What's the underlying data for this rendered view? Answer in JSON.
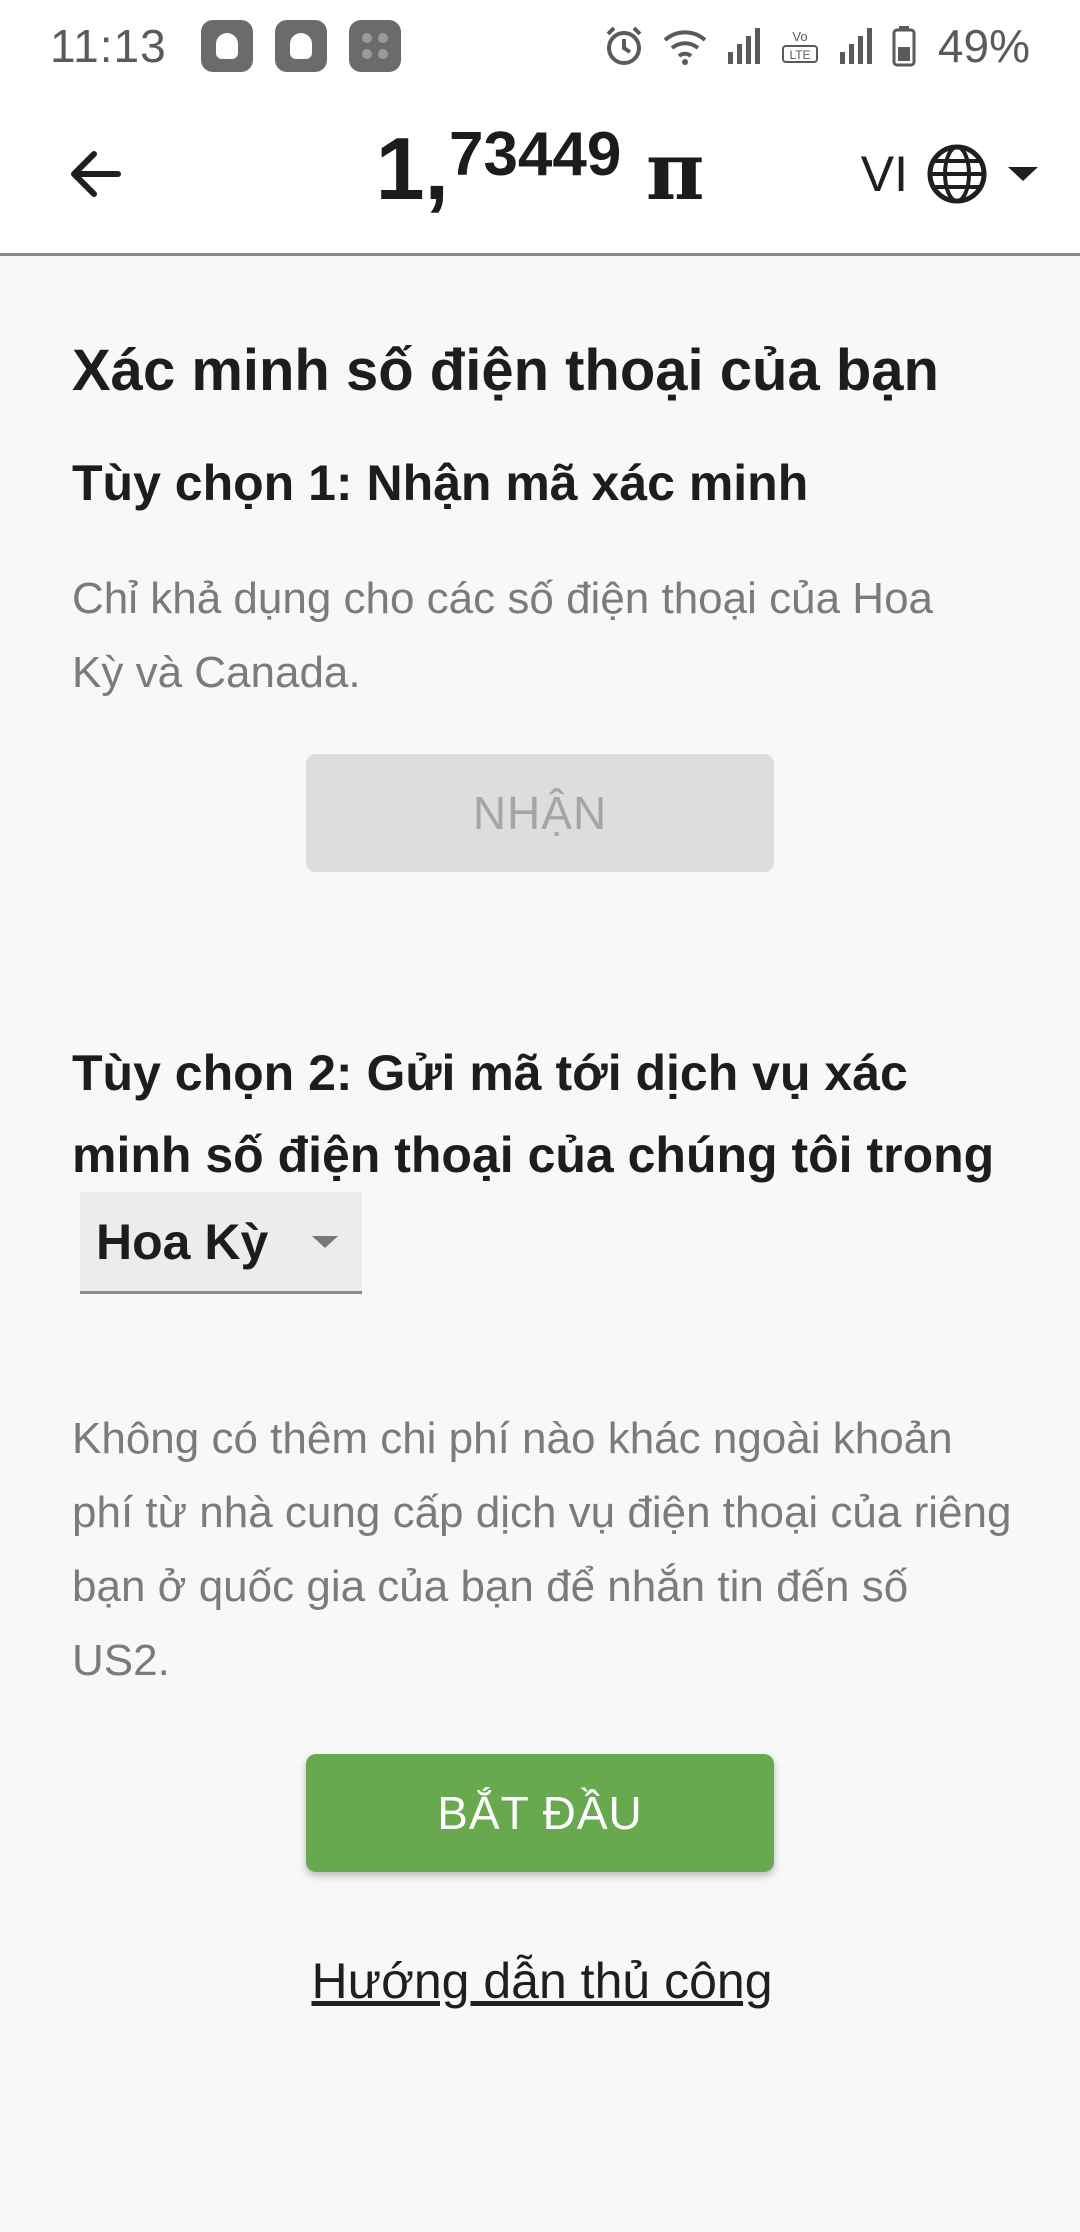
{
  "status_bar": {
    "time": "11:13",
    "battery_percent": "49%",
    "icons": [
      "notification-icon",
      "notification-icon",
      "app-icon",
      "alarm-icon",
      "wifi-icon",
      "signal-icon",
      "volte-icon",
      "signal-icon",
      "battery-icon"
    ]
  },
  "header": {
    "balance_main": "1,",
    "balance_sup": "73449",
    "balance_symbol": "π",
    "language": "VI",
    "back_icon": "arrow-left-icon",
    "globe_icon": "globe-icon"
  },
  "page": {
    "title": "Xác minh số điện thoại của bạn",
    "option1": {
      "title": "Tùy chọn 1: Nhận mã xác minh",
      "description": "Chỉ khả dụng cho các số điện thoại của Hoa Kỳ và Canada.",
      "button_label": "NHẬN"
    },
    "option2": {
      "title_text": "Tùy chọn 2: Gửi mã tới dịch vụ xác minh số điện thoại của chúng tôi trong",
      "country_selected": "Hoa Kỳ",
      "description": "Không có thêm chi phí nào khác ngoài khoản phí từ nhà cung cấp dịch vụ điện thoại của riêng bạn ở quốc gia của bạn để nhắn tin đến số US2.",
      "start_button_label": "BẮT ĐẦU"
    },
    "manual_link": "Hướng dẫn thủ công"
  },
  "colors": {
    "accent_green": "#68a84f",
    "disabled_button": "#dddddd",
    "background": "#f8f8f8"
  }
}
